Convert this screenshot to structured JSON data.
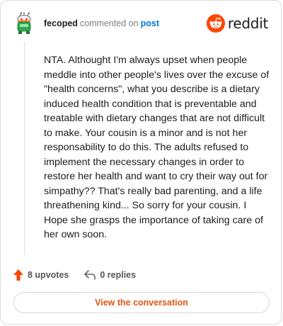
{
  "header": {
    "username": "fecoped",
    "action_text": "commented on",
    "post_link": "post",
    "brand": "reddit"
  },
  "comment": {
    "body": "NTA. Althought I'm always upset when people meddle into other people's lives over the excuse of \"health concerns\", what you describe is a dietary induced health condition that is preventable and treatable with dietary changes that are not difficult to make. Your cousin is a minor and is not her responsability to do this. The adults refused to implement the necessary changes in order to restore her health and want to cry their way out for simpathy?? That's really bad parenting, and a life threathening kind... So sorry for your cousin. I Hope she grasps the importance of taking care of her own soon."
  },
  "actions": {
    "upvotes": "8 upvotes",
    "replies": "0 replies"
  },
  "cta": {
    "label": "View the conversation"
  },
  "colors": {
    "brand_orange": "#ff4500",
    "link_blue": "#0079d3",
    "cta_text": "#e0550f"
  },
  "icons": {
    "avatar": "snoo-avatar-icon",
    "logo": "reddit-snoo-icon",
    "upvote": "upvote-arrow-icon",
    "reply": "reply-arrow-icon"
  }
}
